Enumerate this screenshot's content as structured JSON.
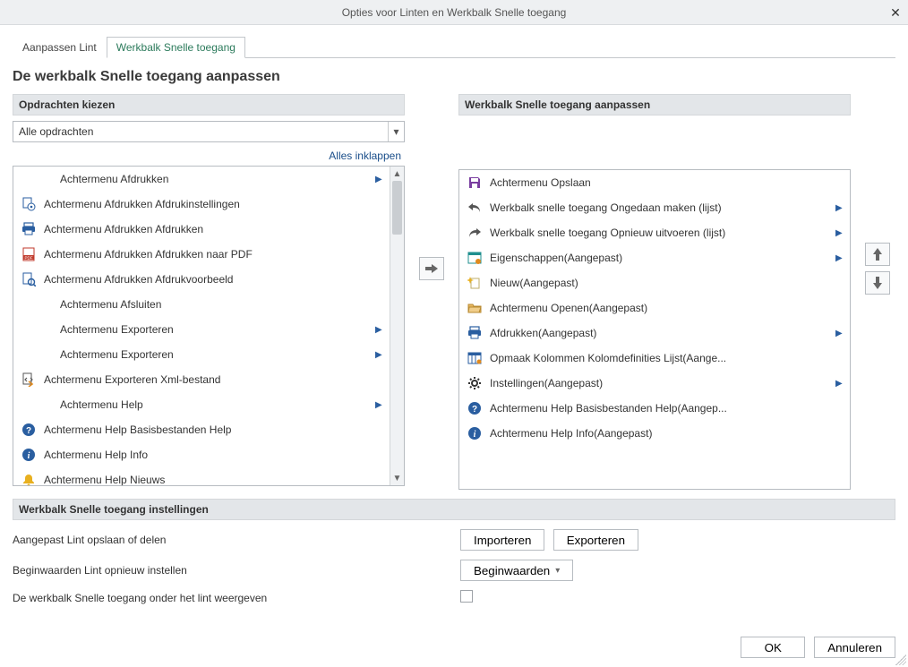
{
  "window": {
    "title": "Opties voor Linten en Werkbalk Snelle toegang"
  },
  "tabs": {
    "customize": "Aanpassen Lint",
    "qat": "Werkbalk Snelle toegang"
  },
  "heading": "De werkbalk Snelle toegang aanpassen",
  "left": {
    "section": "Opdrachten kiezen",
    "combo": "Alle opdrachten",
    "collapse": "Alles inklappen",
    "items": [
      {
        "label": "Achtermenu Afdrukken",
        "icon": "none",
        "expand": true
      },
      {
        "label": "Achtermenu Afdrukken Afdrukinstellingen",
        "icon": "print-settings"
      },
      {
        "label": "Achtermenu Afdrukken Afdrukken",
        "icon": "printer"
      },
      {
        "label": "Achtermenu Afdrukken Afdrukken naar PDF",
        "icon": "pdf"
      },
      {
        "label": "Achtermenu Afdrukken Afdrukvoorbeeld",
        "icon": "preview"
      },
      {
        "label": "Achtermenu Afsluiten",
        "icon": "none"
      },
      {
        "label": "Achtermenu Exporteren",
        "icon": "none",
        "expand": true
      },
      {
        "label": "Achtermenu Exporteren",
        "icon": "none",
        "expand": true
      },
      {
        "label": "Achtermenu Exporteren Xml-bestand",
        "icon": "export-xml"
      },
      {
        "label": "Achtermenu Help",
        "icon": "none",
        "expand": true
      },
      {
        "label": "Achtermenu Help Basisbestanden Help",
        "icon": "help-circle"
      },
      {
        "label": "Achtermenu Help Info",
        "icon": "info-circle"
      },
      {
        "label": "Achtermenu Help Nieuws",
        "icon": "bell"
      }
    ]
  },
  "right": {
    "section": "Werkbalk Snelle toegang aanpassen",
    "items": [
      {
        "label": "Achtermenu Opslaan",
        "icon": "save"
      },
      {
        "label": "Werkbalk snelle toegang Ongedaan maken (lijst)",
        "icon": "undo",
        "expand": true
      },
      {
        "label": "Werkbalk snelle toegang Opnieuw uitvoeren (lijst)",
        "icon": "redo",
        "expand": true
      },
      {
        "label": "Eigenschappen(Aangepast)",
        "icon": "properties",
        "expand": true
      },
      {
        "label": "Nieuw(Aangepast)",
        "icon": "new"
      },
      {
        "label": "Achtermenu Openen(Aangepast)",
        "icon": "open"
      },
      {
        "label": "Afdrukken(Aangepast)",
        "icon": "printer",
        "expand": true
      },
      {
        "label": "Opmaak Kolommen Kolomdefinities Lijst(Aange...",
        "icon": "columns"
      },
      {
        "label": "Instellingen(Aangepast)",
        "icon": "gear",
        "expand": true
      },
      {
        "label": "Achtermenu Help Basisbestanden Help(Aangep...",
        "icon": "help-circle"
      },
      {
        "label": "Achtermenu Help Info(Aangepast)",
        "icon": "info-circle"
      }
    ]
  },
  "settings": {
    "section": "Werkbalk Snelle toegang instellingen",
    "saveShare": "Aangepast Lint opslaan of delen",
    "import": "Importeren",
    "export": "Exporteren",
    "resetLabel": "Beginwaarden Lint opnieuw instellen",
    "resetBtn": "Beginwaarden",
    "showBelow": "De werkbalk Snelle toegang onder het lint weergeven"
  },
  "footer": {
    "ok": "OK",
    "cancel": "Annuleren"
  }
}
